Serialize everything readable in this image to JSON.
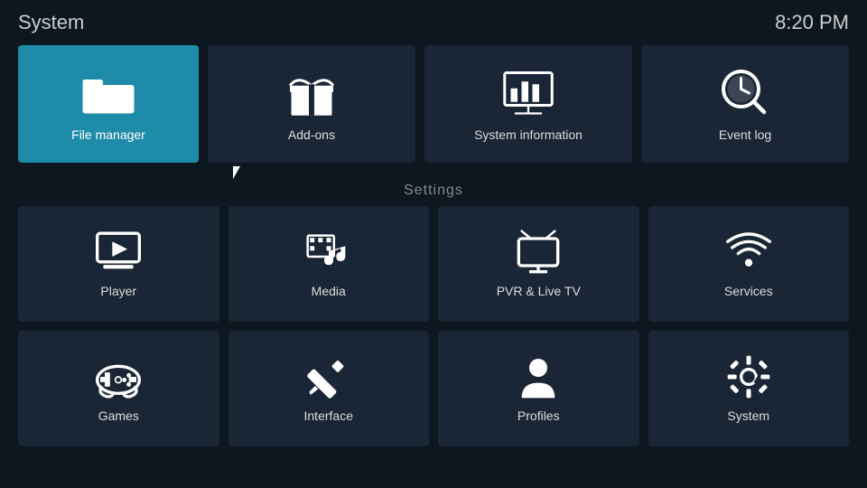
{
  "header": {
    "title": "System",
    "time": "8:20 PM"
  },
  "top_tiles": [
    {
      "id": "file-manager",
      "label": "File manager",
      "highlighted": true
    },
    {
      "id": "add-ons",
      "label": "Add-ons",
      "highlighted": false
    },
    {
      "id": "system-information",
      "label": "System information",
      "highlighted": false
    },
    {
      "id": "event-log",
      "label": "Event log",
      "highlighted": false
    }
  ],
  "settings_label": "Settings",
  "settings_tiles": [
    {
      "id": "player",
      "label": "Player"
    },
    {
      "id": "media",
      "label": "Media"
    },
    {
      "id": "pvr-live-tv",
      "label": "PVR & Live TV"
    },
    {
      "id": "services",
      "label": "Services"
    },
    {
      "id": "games",
      "label": "Games"
    },
    {
      "id": "interface",
      "label": "Interface"
    },
    {
      "id": "profiles",
      "label": "Profiles"
    },
    {
      "id": "system",
      "label": "System"
    }
  ],
  "colors": {
    "highlighted_bg": "#1e8ba8",
    "tile_bg": "#1a2535",
    "body_bg": "#0d1720"
  }
}
